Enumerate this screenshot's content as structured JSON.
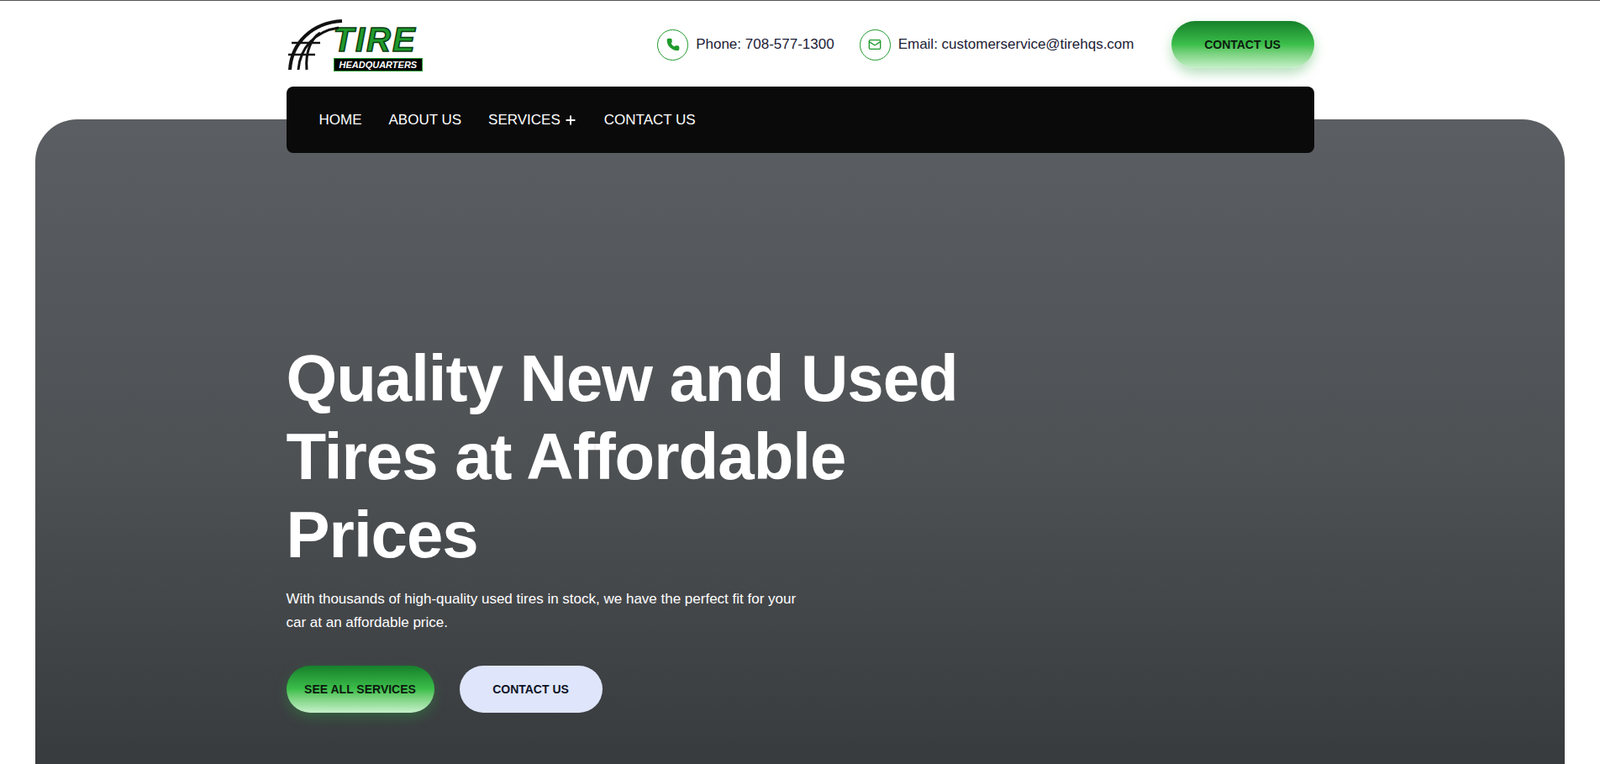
{
  "header": {
    "logo": {
      "title": "TIRE",
      "subtitle": "HEADQUARTERS"
    },
    "contacts": [
      {
        "kind": "phone",
        "label": "Phone:",
        "value": "708-577-1300"
      },
      {
        "kind": "email",
        "label": "Email:",
        "value": "customerservice@tirehqs.com"
      }
    ],
    "cta": "CONTACT US"
  },
  "nav": [
    {
      "label": "HOME",
      "has_submenu": false
    },
    {
      "label": "ABOUT US",
      "has_submenu": false
    },
    {
      "label": "SERVICES",
      "has_submenu": true
    },
    {
      "label": "CONTACT US",
      "has_submenu": false
    }
  ],
  "hero": {
    "heading": "Quality New and Used Tires at Affordable Prices",
    "text": "With thousands of high-quality used tires in stock, we have the perfect fit for your car at an affordable price.",
    "buttons": [
      {
        "label": "SEE ALL SERVICES",
        "kind": "primary"
      },
      {
        "label": "CONTACT US",
        "kind": "secondary"
      }
    ]
  }
}
